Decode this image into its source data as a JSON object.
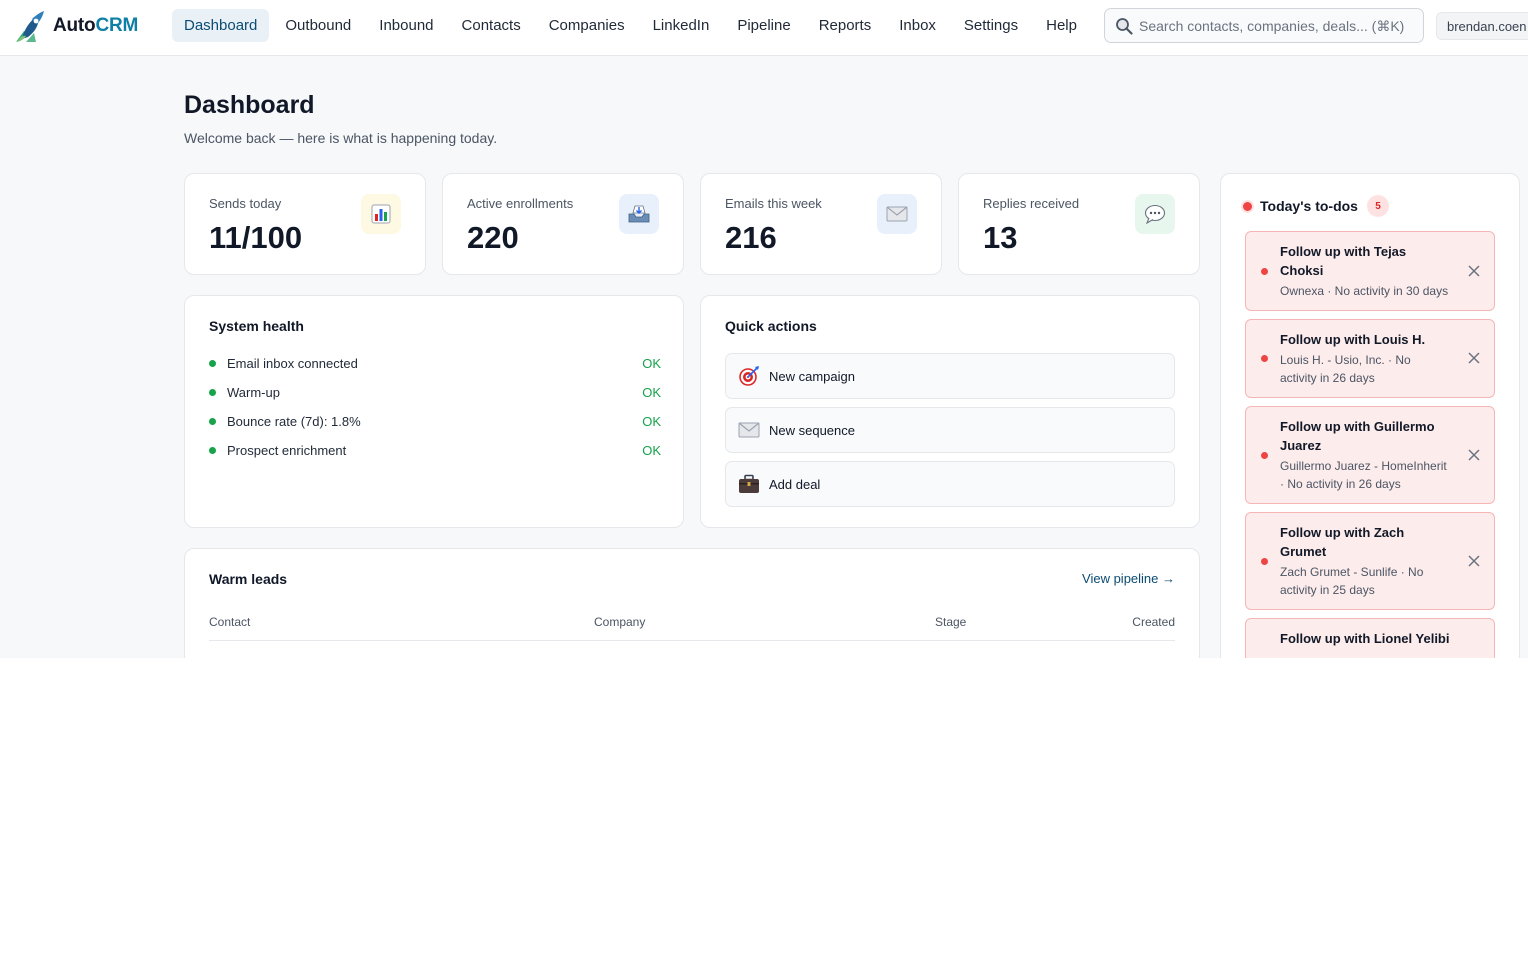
{
  "app": {
    "name_a": "Auto",
    "name_b": "CRM"
  },
  "nav": {
    "items": [
      {
        "label": "Dashboard"
      },
      {
        "label": "Outbound"
      },
      {
        "label": "Inbound"
      },
      {
        "label": "Contacts"
      },
      {
        "label": "Companies"
      },
      {
        "label": "LinkedIn"
      },
      {
        "label": "Pipeline"
      },
      {
        "label": "Reports"
      },
      {
        "label": "Inbox"
      },
      {
        "label": "Settings"
      },
      {
        "label": "Help"
      }
    ],
    "active": "Dashboard"
  },
  "search": {
    "placeholder": "Search contacts, companies, deals... (⌘K)",
    "value": ""
  },
  "user": {
    "email": "brendan.coen"
  },
  "page": {
    "title": "Dashboard",
    "subtitle": "Welcome back — here is what is happening today."
  },
  "stats": [
    {
      "label": "Sends today",
      "value": "11/100",
      "icon": "bar-chart-icon"
    },
    {
      "label": "Active enrollments",
      "value": "220",
      "icon": "inbox-tray-icon"
    },
    {
      "label": "Emails this week",
      "value": "216",
      "icon": "envelope-icon"
    },
    {
      "label": "Replies received",
      "value": "13",
      "icon": "speech-bubble-icon"
    }
  ],
  "system_health": {
    "title": "System health",
    "items": [
      {
        "label": "Email inbox connected",
        "status": "OK"
      },
      {
        "label": "Warm-up",
        "status": "OK"
      },
      {
        "label": "Bounce rate (7d): 1.8%",
        "status": "OK"
      },
      {
        "label": "Prospect enrichment",
        "status": "OK"
      }
    ]
  },
  "quick_actions": {
    "title": "Quick actions",
    "items": [
      {
        "label": "New campaign",
        "icon": "target-icon"
      },
      {
        "label": "New sequence",
        "icon": "envelope-icon"
      },
      {
        "label": "Add deal",
        "icon": "briefcase-icon"
      }
    ]
  },
  "warm_leads": {
    "title": "Warm leads",
    "link": "View pipeline →",
    "columns": [
      "Contact",
      "Company",
      "Stage",
      "Created"
    ]
  },
  "todos": {
    "title": "Today's to-dos",
    "count": "5",
    "items": [
      {
        "title": "Follow up with Tejas Choksi",
        "sub": "Ownexa · No activity in 30 days"
      },
      {
        "title": "Follow up with Louis H.",
        "sub": "Louis H. - Usio, Inc. · No activity in 26 days"
      },
      {
        "title": "Follow up with Guillermo Juarez",
        "sub": "Guillermo Juarez - HomeInherit · No activity in 26 days"
      },
      {
        "title": "Follow up with Zach Grumet",
        "sub": "Zach Grumet - Sunlife · No activity in 25 days"
      },
      {
        "title": "Follow up with Lionel Yelibi",
        "sub": ""
      }
    ]
  },
  "colors": {
    "accent": "#0b4b73",
    "brand": "#0e7fa6",
    "ok": "#16a34a",
    "alert": "#ef4444"
  }
}
